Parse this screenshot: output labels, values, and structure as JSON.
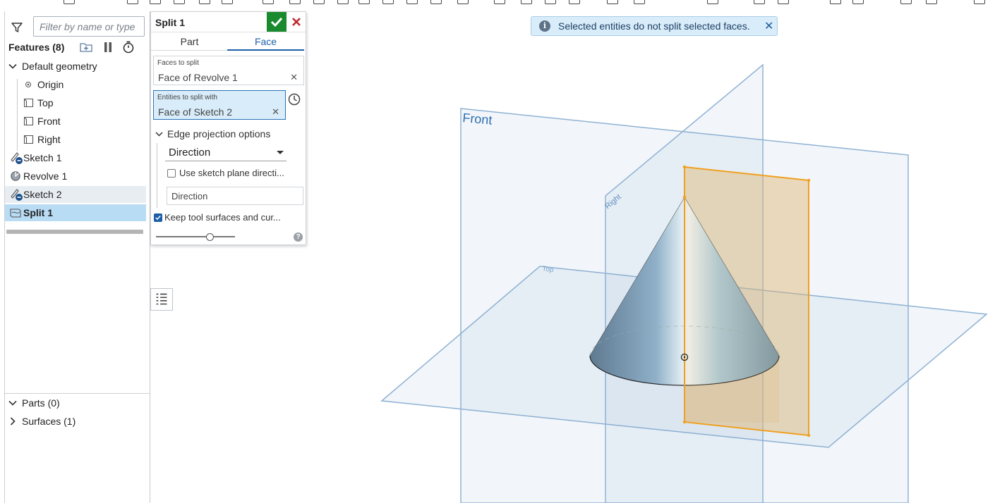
{
  "filter": {
    "placeholder": "Filter by name or type"
  },
  "features": {
    "title": "Features (8)",
    "default_geometry": "Default geometry",
    "items": [
      {
        "label": "Origin"
      },
      {
        "label": "Top"
      },
      {
        "label": "Front"
      },
      {
        "label": "Right"
      },
      {
        "label": "Sketch 1"
      },
      {
        "label": "Revolve 1"
      },
      {
        "label": "Sketch 2"
      },
      {
        "label": "Split 1"
      }
    ]
  },
  "parts": {
    "parts_label": "Parts (0)",
    "surfaces_label": "Surfaces (1)"
  },
  "dialog": {
    "title": "Split 1",
    "tabs": [
      "Part",
      "Face"
    ],
    "active_tab": "Face",
    "faces_to_split_caption": "Faces to split",
    "faces_to_split_value": "Face of Revolve 1",
    "entities_caption": "Entities to split with",
    "entities_value": "Face of Sketch 2",
    "edge_projection": "Edge projection options",
    "direction_select": "Direction",
    "use_sketch_plane": "Use sketch plane directi...",
    "use_sketch_plane_checked": false,
    "direction_placeholder": "Direction",
    "keep_tool_surfaces": "Keep tool surfaces and cur...",
    "keep_tool_surfaces_checked": true,
    "help": "?",
    "accent": "#1b5fa8",
    "ok_color": "#1a8a2e",
    "cancel_color": "#c0282d"
  },
  "notification": {
    "icon": "i",
    "text": "Selected entities do not split selected faces.",
    "close": "✕"
  },
  "viewport": {
    "plane_front": "Front",
    "plane_right": "Right",
    "plane_top": "Top",
    "plane_color": "#7ea6cf",
    "sketch_plane_color": "#f0a020"
  }
}
